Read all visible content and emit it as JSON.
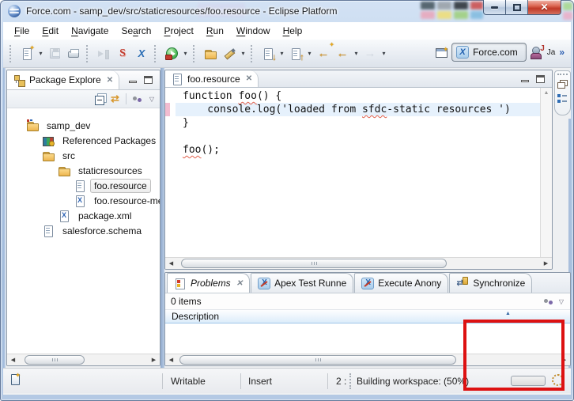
{
  "icons": {
    "close_x": "✕",
    "dropdown": "▾",
    "overflow": "»",
    "scroll_left": "◀",
    "scroll_right": "▶",
    "scroll_up": "▲",
    "sort_asc": "▲",
    "view_menu_arrow": "▽",
    "link_with_editor": "⇄",
    "back_arrow": "←",
    "forward_arrow": "→",
    "next_annotation": "↓",
    "prev_annotation": "↑",
    "last_edit": "←",
    "x_logo": "X",
    "s_logo": "S",
    "java_logo": "J"
  },
  "window": {
    "title": "Force.com - samp_dev/src/staticresources/foo.resource - Eclipse Platform"
  },
  "menu": {
    "items": [
      {
        "label": "File",
        "u": 0
      },
      {
        "label": "Edit",
        "u": 0
      },
      {
        "label": "Navigate",
        "u": 0
      },
      {
        "label": "Search",
        "u": 2
      },
      {
        "label": "Project",
        "u": 0
      },
      {
        "label": "Run",
        "u": 0
      },
      {
        "label": "Window",
        "u": 0
      },
      {
        "label": "Help",
        "u": 0
      }
    ]
  },
  "perspective_bar": {
    "force_label": "Force.com",
    "java_label": "Ja"
  },
  "package_explorer": {
    "title": "Package Explore",
    "tree": [
      {
        "label": "samp_dev",
        "icon": "project-folder-icon",
        "level": 0
      },
      {
        "label": "Referenced Packages",
        "icon": "referenced-packages-icon",
        "level": 1
      },
      {
        "label": "src",
        "icon": "folder-icon",
        "level": 1
      },
      {
        "label": "staticresources",
        "icon": "folder-icon",
        "level": 2
      },
      {
        "label": "foo.resource",
        "icon": "file-icon",
        "level": 3,
        "selected": true
      },
      {
        "label": "foo.resource-me",
        "icon": "xml-file-icon",
        "level": 3
      },
      {
        "label": "package.xml",
        "icon": "xml-file-icon",
        "level": 2
      },
      {
        "label": "salesforce.schema",
        "icon": "file-icon",
        "level": 1
      }
    ]
  },
  "editor": {
    "tab_label": "foo.resource",
    "lines": [
      {
        "segments": [
          {
            "t": "function "
          },
          {
            "t": "foo",
            "error": true
          },
          {
            "t": "() {"
          }
        ]
      },
      {
        "highlight": true,
        "marker": true,
        "segments": [
          {
            "t": "    console.log('loaded from "
          },
          {
            "t": "sfdc",
            "error": true
          },
          {
            "t": "-static resources ')"
          }
        ]
      },
      {
        "segments": [
          {
            "t": "}"
          }
        ]
      },
      {
        "segments": []
      },
      {
        "segments": [
          {
            "t": "foo",
            "error": true
          },
          {
            "t": "();"
          }
        ]
      }
    ]
  },
  "problems": {
    "tabs": [
      {
        "label": "Problems",
        "icon": "problems-icon",
        "active": true,
        "closable": true
      },
      {
        "label": "Apex Test Runne",
        "icon": "apex-icon"
      },
      {
        "label": "Execute Anony",
        "icon": "apex-icon"
      },
      {
        "label": "Synchronize",
        "icon": "sync-icon"
      }
    ],
    "items_label": "0 items",
    "column_header": "Description"
  },
  "status_bar": {
    "writable": "Writable",
    "insert_mode": "Insert",
    "caret_position": "2 :",
    "message": "Building workspace: (50%)",
    "progress_percent": 50
  },
  "colors": {
    "annotation_red": "#dd1111",
    "selection_line": "#e6f1fc",
    "aero_glass": "#bdd3ec"
  }
}
